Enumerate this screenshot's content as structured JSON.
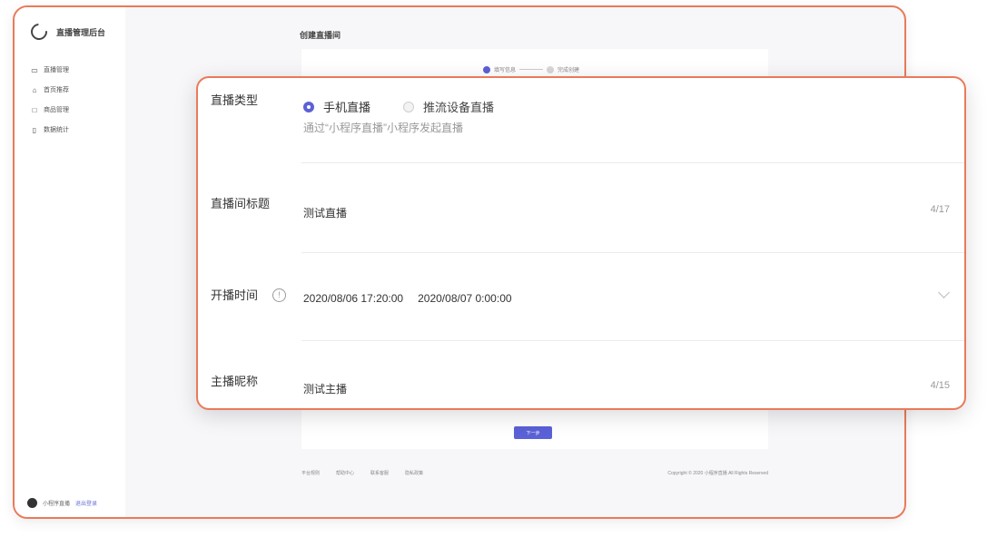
{
  "app": {
    "title": "直播管理后台"
  },
  "sidebar": {
    "items": [
      {
        "label": "直播管理",
        "icon": "camera-icon"
      },
      {
        "label": "首页推荐",
        "icon": "home-icon"
      },
      {
        "label": "商品管理",
        "icon": "box-icon"
      },
      {
        "label": "数据统计",
        "icon": "document-icon"
      }
    ],
    "footer_user": "小程序直播",
    "footer_link": "退出登录"
  },
  "main": {
    "title": "创建直播间",
    "steps": [
      {
        "label": "填写信息"
      },
      {
        "label": "完成创建"
      }
    ],
    "next_button": "下一步",
    "footer_links": [
      "平台规则",
      "帮助中心",
      "联系客服",
      "隐私政策"
    ],
    "footer_copyright": "Copyright © 2020 小程序直播 All Rights Reserved"
  },
  "form": {
    "type": {
      "label": "直播类型",
      "options": [
        {
          "label": "手机直播",
          "checked": true
        },
        {
          "label": "推流设备直播",
          "checked": false
        }
      ],
      "hint": "通过“小程序直播”小程序发起直播"
    },
    "title": {
      "label": "直播间标题",
      "value": "测试直播",
      "counter": "4/17"
    },
    "time": {
      "label": "开播时间",
      "start": "2020/08/06 17:20:00",
      "end": "2020/08/07 0:00:00"
    },
    "anchor": {
      "label": "主播昵称",
      "value": "测试主播",
      "counter": "4/15"
    }
  },
  "colors": {
    "accent": "#5b61d6",
    "highlight_border": "#ea7a5a"
  }
}
